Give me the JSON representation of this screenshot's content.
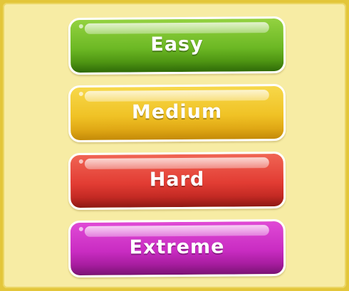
{
  "difficulty_menu": {
    "buttons": [
      {
        "label": "Easy",
        "color": "#6cb824"
      },
      {
        "label": "Medium",
        "color": "#f0c225"
      },
      {
        "label": "Hard",
        "color": "#e23c33"
      },
      {
        "label": "Extreme",
        "color": "#c92cc2"
      }
    ]
  }
}
